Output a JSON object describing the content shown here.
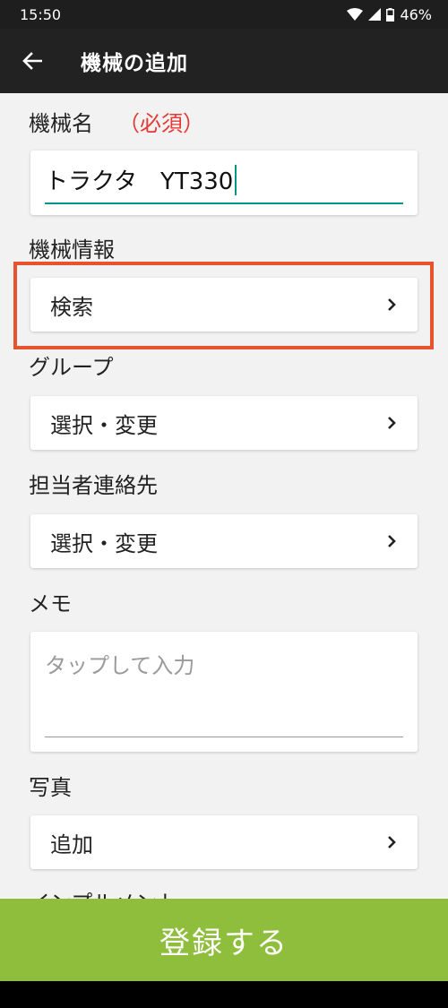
{
  "status_bar": {
    "time": "15:50",
    "battery": "46%"
  },
  "app_bar": {
    "title": "機械の追加",
    "back_icon": "arrow-back-icon"
  },
  "form": {
    "name_label": "機械名",
    "name_required": "（必須）",
    "name_value": "トラクタ　YT330",
    "info_label": "機械情報",
    "info_action": "検索",
    "group_label": "グループ",
    "group_action": "選択・変更",
    "contact_label": "担当者連絡先",
    "contact_action": "選択・変更",
    "memo_label": "メモ",
    "memo_placeholder": "タップして入力",
    "photo_label": "写真",
    "photo_action": "追加",
    "implement_label": "インプルメント"
  },
  "register_button": "登録する",
  "colors": {
    "accent_teal": "#009688",
    "required_red": "#e53935",
    "button_green": "#8fbd3c",
    "highlight": "#e8532f",
    "app_bar": "#222222"
  }
}
